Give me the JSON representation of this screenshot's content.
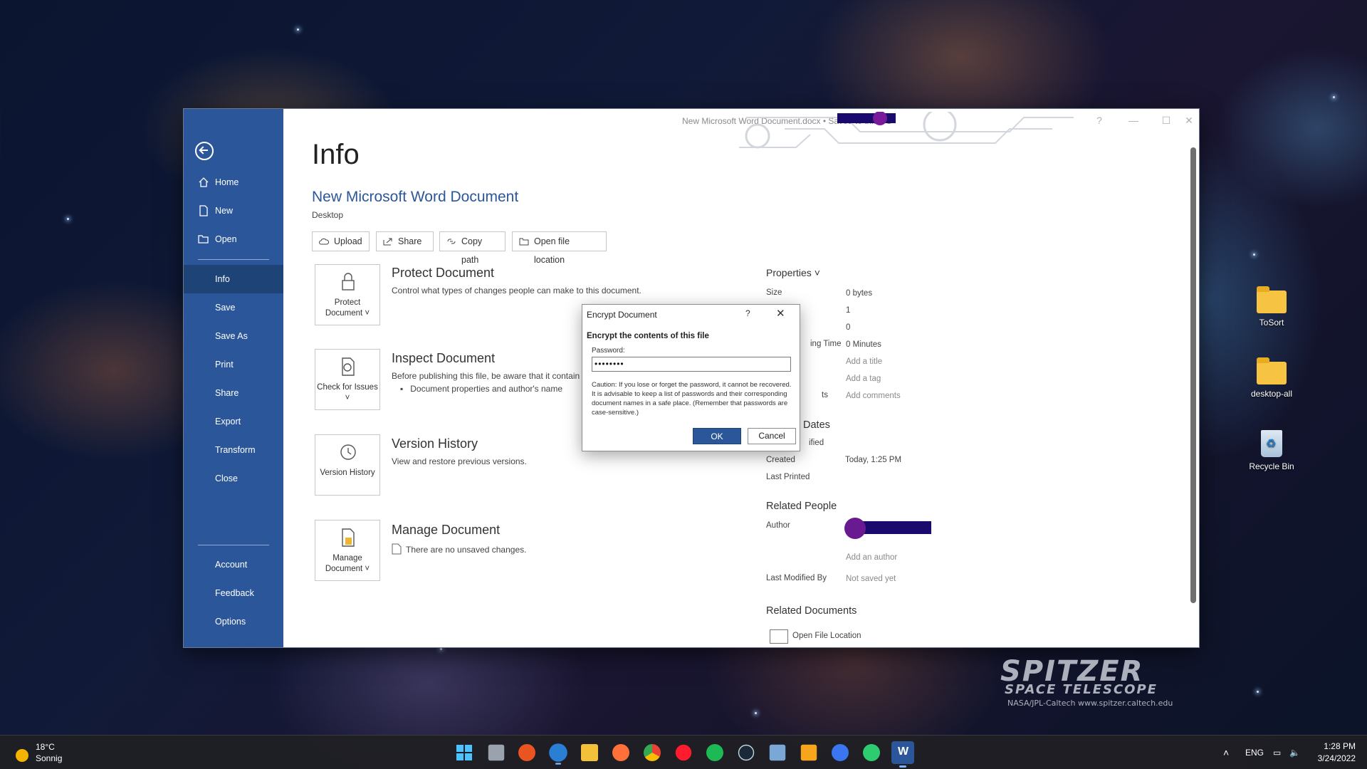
{
  "window": {
    "title": "New Microsoft Word Document.docx • Saved to this PC",
    "controls": {
      "help": "?",
      "minimize": "—",
      "maximize": "☐",
      "close": "✕"
    }
  },
  "sidebar": {
    "items": [
      {
        "label": "Home",
        "icon": "home-icon"
      },
      {
        "label": "New",
        "icon": "new-document-icon"
      },
      {
        "label": "Open",
        "icon": "folder-open-icon"
      },
      {
        "label": "Info",
        "active": true
      },
      {
        "label": "Save"
      },
      {
        "label": "Save As"
      },
      {
        "label": "Print"
      },
      {
        "label": "Share"
      },
      {
        "label": "Export"
      },
      {
        "label": "Transform"
      },
      {
        "label": "Close"
      },
      {
        "label": "Account"
      },
      {
        "label": "Feedback"
      },
      {
        "label": "Options"
      }
    ]
  },
  "info": {
    "page_title": "Info",
    "doc_name": "New Microsoft Word Document",
    "doc_location": "Desktop",
    "actions": [
      "Upload",
      "Share",
      "Copy path",
      "Open file location"
    ],
    "sections": [
      {
        "tile": "Protect Document ˅",
        "title": "Protect Document",
        "desc": "Control what types of changes people can make to this document."
      },
      {
        "tile": "Check for Issues ˅",
        "title": "Inspect Document",
        "desc": "Before publishing this file, be aware that it contain",
        "bullet": "Document properties and author's name"
      },
      {
        "tile": "Version History",
        "title": "Version History",
        "desc": "View and restore previous versions."
      },
      {
        "tile": "Manage Document ˅",
        "title": "Manage Document",
        "desc": "There are no unsaved changes."
      }
    ]
  },
  "properties": {
    "header": "Properties ˅",
    "size_label": "Size",
    "size_value": "0 bytes",
    "pages_value": "1",
    "words_value": "0",
    "editing_label": "ing Time",
    "editing_value": "0 Minutes",
    "title_value": "Add a title",
    "tags_value": "Add a tag",
    "comments_label": "ts",
    "comments_value": "Add comments",
    "dates_header": "Dates",
    "modified_label": "ified",
    "created_label": "Created",
    "created_value": "Today, 1:25 PM",
    "printed_label": "Last Printed",
    "people_header": "Related People",
    "author_label": "Author",
    "add_author": "Add an author",
    "modified_by_label": "Last Modified By",
    "modified_by_value": "Not saved yet",
    "related_docs_header": "Related Documents",
    "open_location": "Open File Location"
  },
  "dialog": {
    "title": "Encrypt Document",
    "help": "?",
    "close": "✕",
    "heading": "Encrypt the contents of this file",
    "password_label": "Password:",
    "password_value": "••••••••",
    "caution": "Caution: If you lose or forget the password, it cannot be recovered. It is advisable to keep a list of passwords and their corresponding document names in a safe place. (Remember that passwords are case-sensitive.)",
    "ok": "OK",
    "cancel": "Cancel"
  },
  "desktop": {
    "icons": [
      {
        "label": "ToSort",
        "icon": "folder-icon"
      },
      {
        "label": "desktop-all",
        "icon": "folder-icon"
      },
      {
        "label": "Recycle Bin",
        "icon": "recycle-bin-icon"
      }
    ],
    "watermark": {
      "line1": "SPITZER",
      "line2": "SPACE TELESCOPE",
      "line3": "NASA/JPL-Caltech   www.spitzer.caltech.edu"
    }
  },
  "taskbar": {
    "weather_temp": "18°C",
    "weather_desc": "Sonnig",
    "apps": [
      "start",
      "task-view",
      "ubuntu",
      "thunderbird",
      "file-explorer",
      "firefox",
      "chrome",
      "opera",
      "spotify",
      "steam",
      "photos",
      "snipping",
      "signal",
      "vpn",
      "word"
    ],
    "language": "ENG",
    "time": "1:28 PM",
    "date": "3/24/2022"
  },
  "colors": {
    "accent": "#2b579a",
    "sidebar_active": "#1e4377",
    "redaction": "#1a0a6e"
  }
}
